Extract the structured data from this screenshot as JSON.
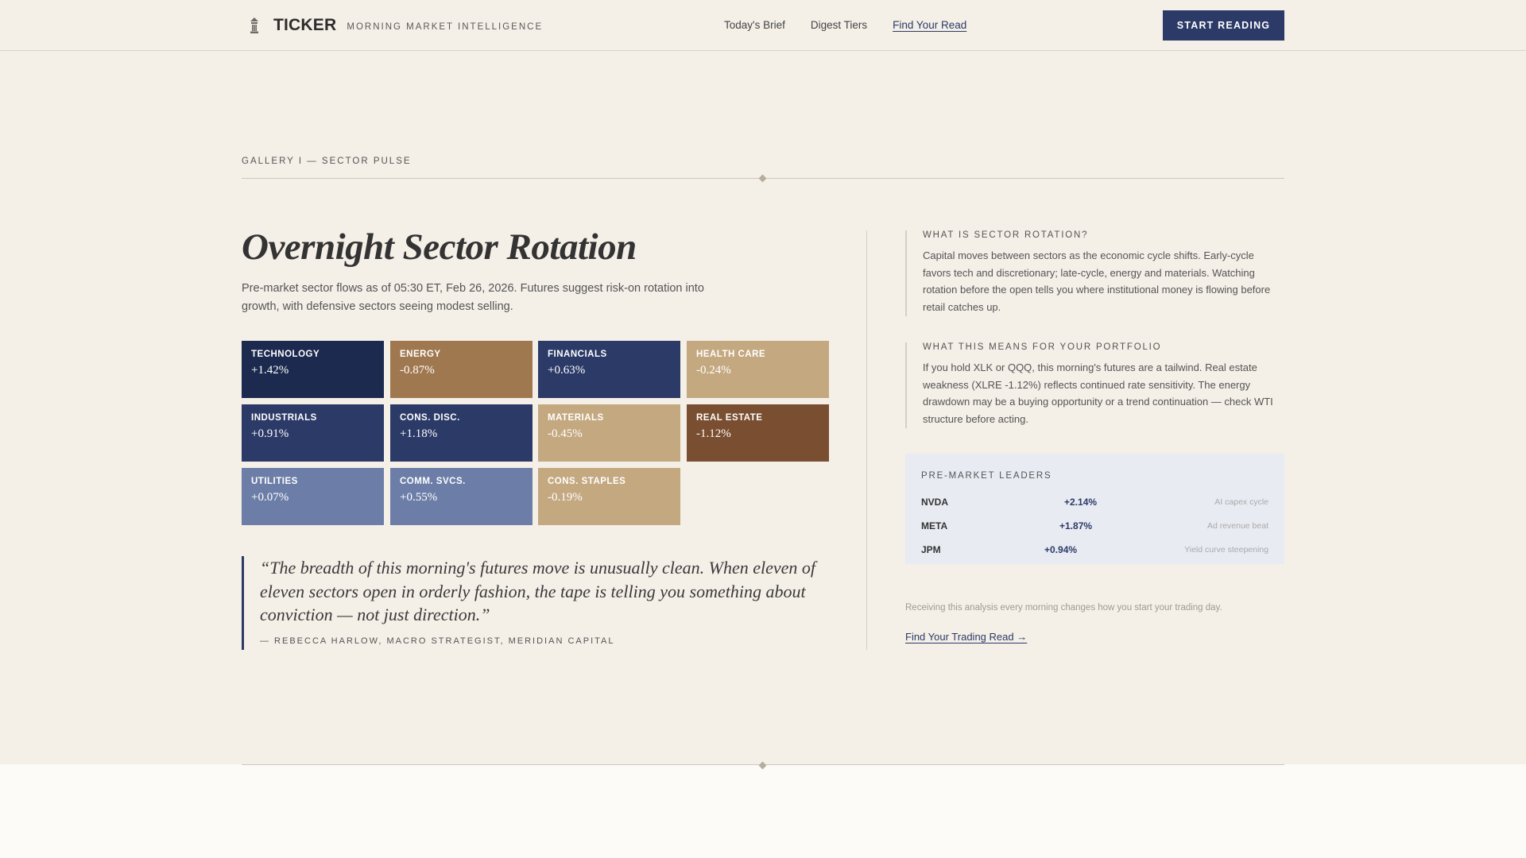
{
  "header": {
    "brand": "TICKER",
    "tagline": "MORNING MARKET INTELLIGENCE",
    "nav": [
      "Today's Brief",
      "Digest Tiers",
      "Find Your Read"
    ],
    "active_nav": "Find Your Read",
    "cta": "START READING"
  },
  "gallery_label": "GALLERY I — SECTOR PULSE",
  "main": {
    "title": "Overnight Sector Rotation",
    "subtitle": "Pre-market sector flows as of 05:30 ET, Feb 26, 2026. Futures suggest risk-on rotation into growth, with defensive sectors seeing modest selling.",
    "sectors": [
      {
        "name": "TECHNOLOGY",
        "change": "+1.42%",
        "color": "#1c2a4f"
      },
      {
        "name": "ENERGY",
        "change": "-0.87%",
        "color": "#a07850"
      },
      {
        "name": "FINANCIALS",
        "change": "+0.63%",
        "color": "#2b3a67"
      },
      {
        "name": "HEALTH CARE",
        "change": "-0.24%",
        "color": "#c4a880"
      },
      {
        "name": "INDUSTRIALS",
        "change": "+0.91%",
        "color": "#2b3a67"
      },
      {
        "name": "CONS. DISC.",
        "change": "+1.18%",
        "color": "#2b3a67"
      },
      {
        "name": "MATERIALS",
        "change": "-0.45%",
        "color": "#c4a880"
      },
      {
        "name": "REAL ESTATE",
        "change": "-1.12%",
        "color": "#7a4e30"
      },
      {
        "name": "UTILITIES",
        "change": "+0.07%",
        "color": "#6c7ea8"
      },
      {
        "name": "COMM. SVCS.",
        "change": "+0.55%",
        "color": "#6c7ea8"
      },
      {
        "name": "CONS. STAPLES",
        "change": "-0.19%",
        "color": "#c4a880"
      }
    ],
    "quote": "“The breadth of this morning's futures move is unusually clean. When eleven of eleven sectors open in orderly fashion, the tape is telling you something about conviction — not just direction.”",
    "quote_by": "— REBECCA HARLOW, MACRO STRATEGIST, MERIDIAN CAPITAL"
  },
  "aside": {
    "block1": {
      "heading": "WHAT IS SECTOR ROTATION?",
      "body": "Capital moves between sectors as the economic cycle shifts. Early-cycle favors tech and discretionary; late-cycle, energy and materials. Watching rotation before the open tells you where institutional money is flowing before retail catches up."
    },
    "block2": {
      "heading": "WHAT THIS MEANS FOR YOUR PORTFOLIO",
      "body": "If you hold XLK or QQQ, this morning's futures are a tailwind. Real estate weakness (XLRE -1.12%) reflects continued rate sensitivity. The energy drawdown may be a buying opportunity or a trend continuation — check WTI structure before acting."
    },
    "leaders": {
      "heading": "PRE-MARKET LEADERS",
      "rows": [
        {
          "symbol": "NVDA",
          "change": "+2.14%",
          "note": "AI capex cycle"
        },
        {
          "symbol": "META",
          "change": "+1.87%",
          "note": "Ad revenue beat"
        },
        {
          "symbol": "JPM",
          "change": "+0.94%",
          "note": "Yield curve steepening"
        }
      ]
    },
    "footer_text": "Receiving this analysis every morning changes how you start your trading day.",
    "footer_link": "Find Your Trading Read →"
  },
  "colors": {
    "accent": "#2b3a67",
    "background": "#f4efe7"
  }
}
